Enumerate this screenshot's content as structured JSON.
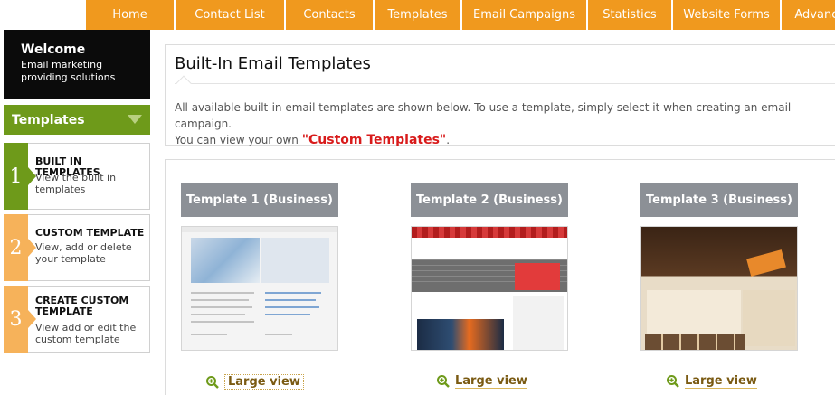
{
  "nav": {
    "tabs": [
      {
        "label": "Home"
      },
      {
        "label": "Contact List"
      },
      {
        "label": "Contacts"
      },
      {
        "label": "Templates"
      },
      {
        "label": "Email Campaigns"
      },
      {
        "label": "Statistics"
      },
      {
        "label": "Website Forms"
      },
      {
        "label": "Advanced"
      }
    ]
  },
  "welcome": {
    "title": "Welcome",
    "subtitle": "Email marketing providing solutions"
  },
  "sidebar": {
    "section_title": "Templates",
    "steps": [
      {
        "number": "1",
        "title": "BUILT IN TEMPLATES",
        "desc": "View the built in templates"
      },
      {
        "number": "2",
        "title": "CUSTOM TEMPLATE",
        "desc": "View, add or delete your template"
      },
      {
        "number": "3",
        "title": "CREATE CUSTOM TEMPLATE",
        "desc": "View add or edit the custom template"
      }
    ]
  },
  "main": {
    "title": "Built-In Email Templates",
    "desc_line1": "All available built-in email templates are shown below. To use a template, simply select it when creating an email campaign.",
    "desc_prefix": "You can view your own ",
    "desc_link": "\"Custom Templates\"",
    "desc_suffix": "."
  },
  "templates": [
    {
      "name": "Template 1 (Business)",
      "action": "Large view"
    },
    {
      "name": "Template 2 (Business)",
      "action": "Large view"
    },
    {
      "name": "Template 3 (Business)",
      "action": "Large view"
    }
  ],
  "colors": {
    "nav": "#f0991e",
    "welcome_bg": "#0b0b0b",
    "section_green": "#6e9a1a",
    "step_orange": "#f6b25a",
    "link_red": "#d81b1b",
    "card_label": "#8c9096"
  }
}
